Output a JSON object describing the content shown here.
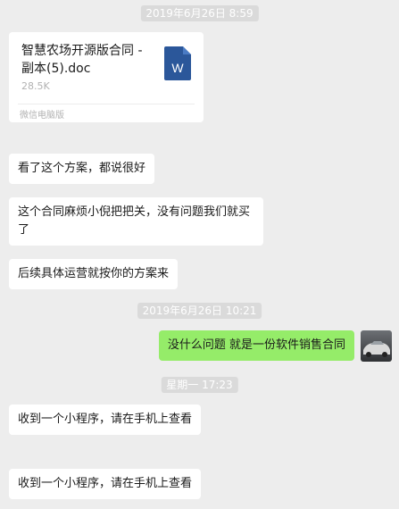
{
  "timestamps": [
    "2019年6月26日  8:59",
    "2019年6月26日  10:21",
    "星期一 17:23"
  ],
  "file": {
    "name": "智慧农场开源版合同 - 副本(5).doc",
    "size": "28.5K",
    "source": "微信电脑版",
    "icon_letter": "W",
    "icon": "word-doc-icon",
    "icon_color": "#2b579a"
  },
  "messages": [
    {
      "side": "in",
      "text": "看了这个方案，都说很好"
    },
    {
      "side": "in",
      "text": "这个合同麻烦小倪把把关，没有问题我们就买了"
    },
    {
      "side": "in",
      "text": "后续具体运营就按你的方案来"
    },
    {
      "side": "out",
      "text": "没什么问题 就是一份软件销售合同"
    },
    {
      "side": "in",
      "text": "收到一个小程序，请在手机上查看"
    },
    {
      "side": "in",
      "text": "收到一个小程序，请在手机上查看"
    }
  ],
  "colors": {
    "background": "#ededed",
    "incoming_bubble": "#ffffff",
    "outgoing_bubble": "#95ec69",
    "timestamp_bg": "#dadada"
  }
}
